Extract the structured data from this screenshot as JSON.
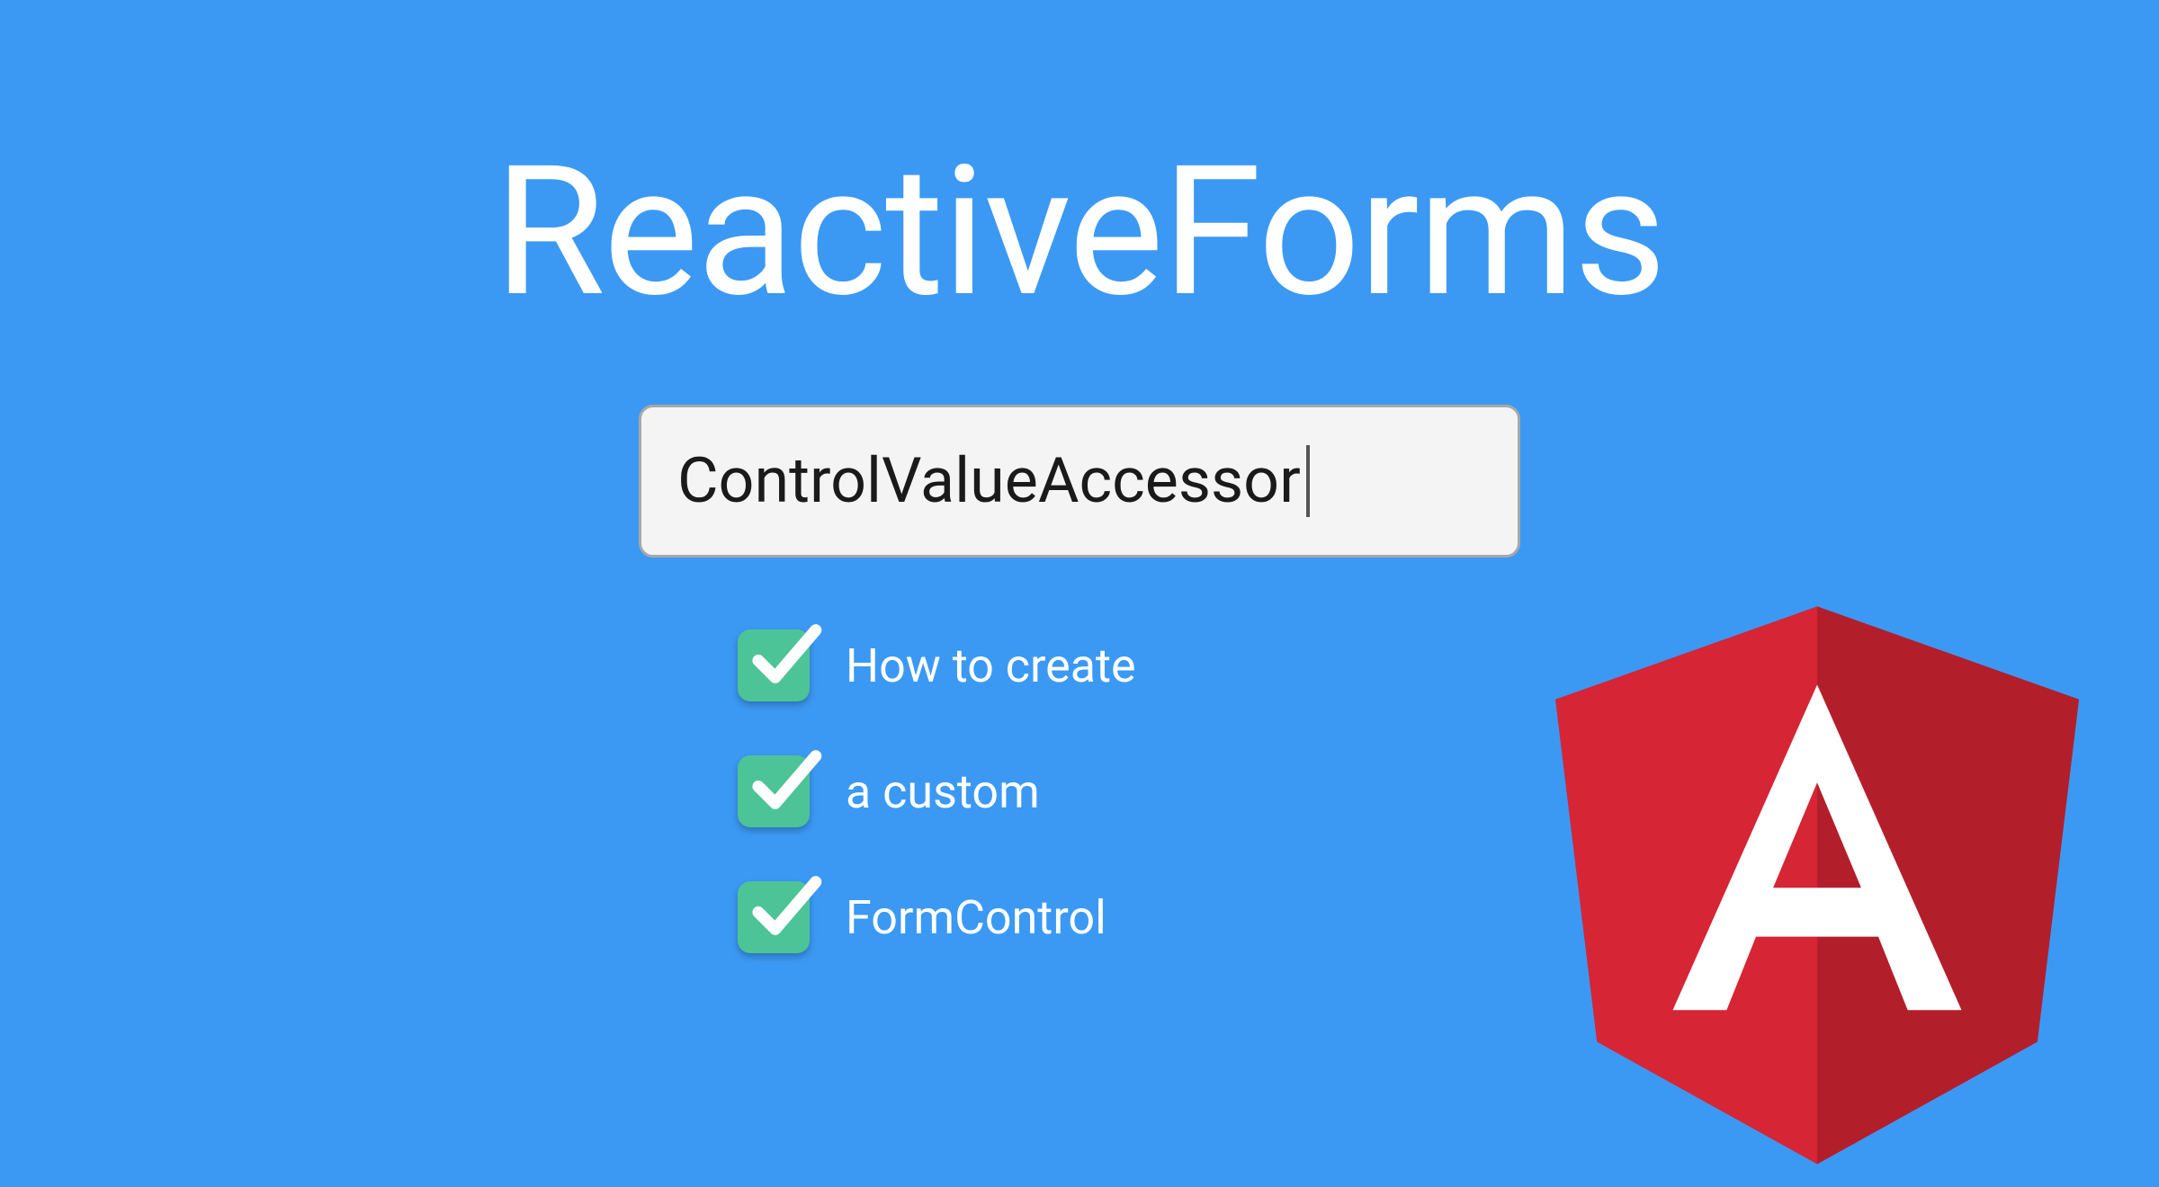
{
  "title": "ReactiveForms",
  "input": {
    "value": "ControlValueAccessor"
  },
  "bullets": [
    {
      "label": "How to create"
    },
    {
      "label": "a custom"
    },
    {
      "label": "FormControl"
    }
  ],
  "colors": {
    "background": "#3b99f4",
    "checkbox": "#4cc497",
    "angular_red": "#d62535",
    "angular_dark_red": "#b21f2b"
  }
}
